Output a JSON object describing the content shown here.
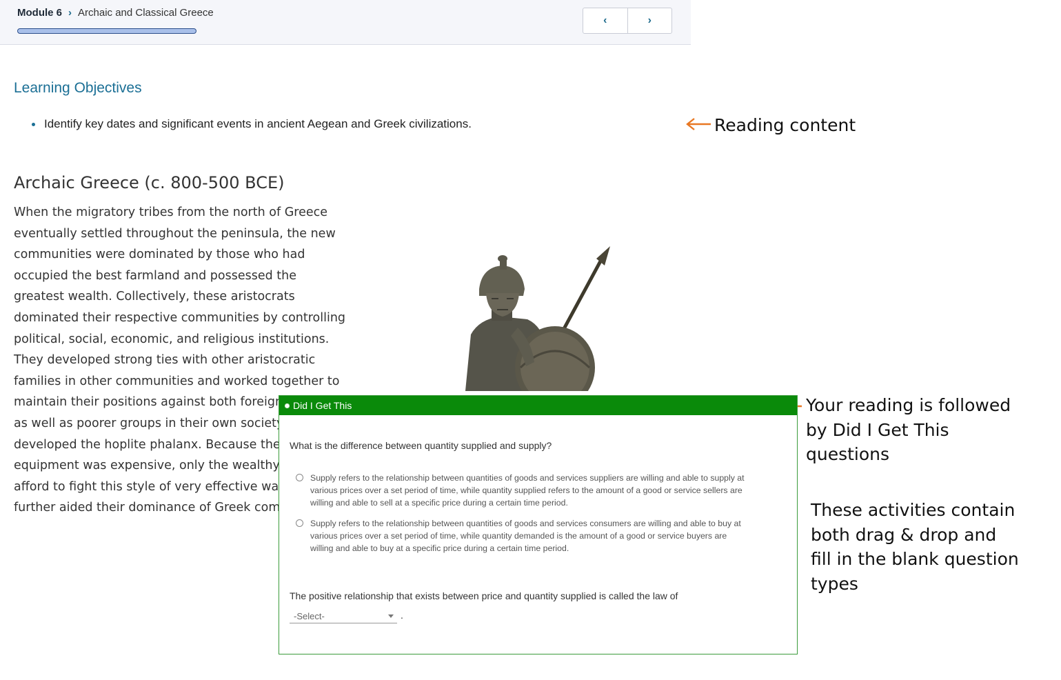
{
  "header": {
    "module": "Module 6",
    "title": "Archaic and Classical Greece",
    "progress_fraction": 0.0,
    "prev_label": "‹",
    "next_label": "›"
  },
  "objectives": {
    "title": "Learning Objectives",
    "items": [
      "Identify key dates and significant events in ancient Aegean and Greek civilizations."
    ]
  },
  "article": {
    "title": "Archaic Greece (c. 800-500 BCE)",
    "lines": [
      "When the migratory tribes from the north of Greece",
      "eventually settled throughout the peninsula, the new",
      "communities were dominated by those who had",
      "occupied the best farmland and possessed the",
      "greatest wealth. Collectively, these aristocrats",
      "dominated their respective communities by controlling",
      "political, social, economic, and religious institutions.",
      "They developed strong ties with other aristocratic",
      "families in other communities and worked together to",
      "maintain their positions against both foreign",
      "as well as poorer groups in their own society.",
      "developed the hoplite phalanx. Because the",
      "equipment was expensive, only the wealthy c",
      "afford to fight this style of very effective warf.",
      "further aided their dominance of Greek comr"
    ]
  },
  "annotations": {
    "reading": "Reading content",
    "digt_lines": [
      "Your reading is followed",
      "by Did I Get This",
      "questions"
    ],
    "activities_lines": [
      "These activities contain",
      "both drag & drop and",
      "fill in the blank question",
      "types"
    ],
    "arrow_color": "#e87722"
  },
  "did_i_get_this": {
    "title": "Did I Get This",
    "question1": "What is the difference between quantity supplied and supply?",
    "options": [
      [
        "Supply refers to the relationship between quantities of goods and services suppliers are willing and able to supply at",
        "various prices over a set period of time, while quantity supplied refers to the amount of a good or service sellers are",
        "willing and able to sell at a specific price during a certain time period."
      ],
      [
        "Supply refers to the relationship between quantities of goods and services consumers are willing and able to buy at",
        "various prices over a set period of time, while quantity demanded is the amount of a good or service buyers are",
        "willing and able to buy at a specific price during a certain time period."
      ]
    ],
    "question2": "The positive relationship that exists between price and quantity supplied is called the law of",
    "select_placeholder": "-Select-",
    "select_suffix": ".",
    "header_color": "#0a8a0a"
  }
}
